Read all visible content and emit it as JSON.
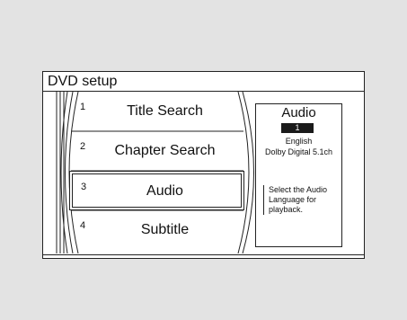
{
  "window": {
    "title": "DVD setup"
  },
  "menu": {
    "items": [
      {
        "number": "1",
        "label": "Title Search"
      },
      {
        "number": "2",
        "label": "Chapter Search"
      },
      {
        "number": "3",
        "label": "Audio"
      },
      {
        "number": "4",
        "label": "Subtitle"
      }
    ]
  },
  "info": {
    "title": "Audio",
    "badge": "1",
    "language": "English",
    "format": "Dolby Digital 5.1ch",
    "help": "Select the Audio Language for playback."
  }
}
